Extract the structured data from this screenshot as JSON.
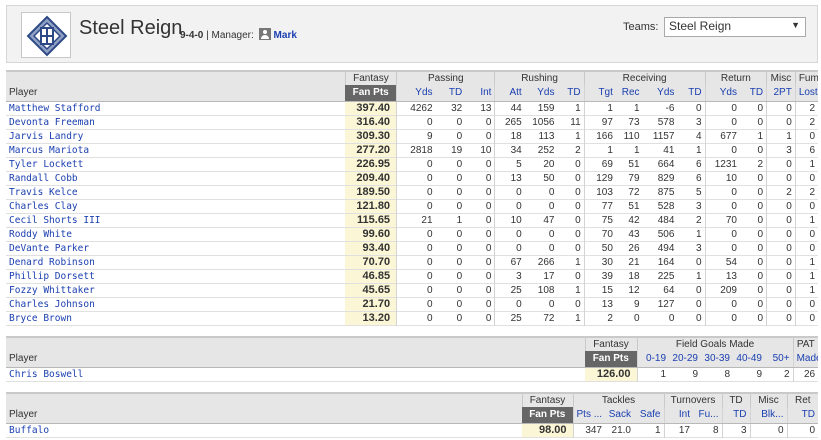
{
  "header": {
    "team_name": "Steel Reign",
    "record": "9-4-0",
    "manager_label": "| Manager:",
    "manager_name": "Mark",
    "teams_label": "Teams:",
    "teams_selected": "Steel Reign",
    "logo": "helmet-logo-icon"
  },
  "offense": {
    "groups": [
      "Fantasy",
      "Passing",
      "Rushing",
      "Receiving",
      "Return",
      "Misc",
      "Fum"
    ],
    "columns": [
      "Player",
      "Fan Pts",
      "Yds",
      "TD",
      "Int",
      "Att",
      "Yds",
      "TD",
      "Tgt",
      "Rec",
      "Yds",
      "TD",
      "Yds",
      "TD",
      "2PT",
      "Lost"
    ],
    "rows": [
      {
        "name": "Matthew Stafford",
        "pts": "397.40",
        "stats": [
          "4262",
          "32",
          "13",
          "44",
          "159",
          "1",
          "1",
          "1",
          "-6",
          "0",
          "0",
          "0",
          "0",
          "2"
        ]
      },
      {
        "name": "Devonta Freeman",
        "pts": "316.40",
        "stats": [
          "0",
          "0",
          "0",
          "265",
          "1056",
          "11",
          "97",
          "73",
          "578",
          "3",
          "0",
          "0",
          "0",
          "2"
        ]
      },
      {
        "name": "Jarvis Landry",
        "pts": "309.30",
        "stats": [
          "9",
          "0",
          "0",
          "18",
          "113",
          "1",
          "166",
          "110",
          "1157",
          "4",
          "677",
          "1",
          "1",
          "0"
        ]
      },
      {
        "name": "Marcus Mariota",
        "pts": "277.20",
        "stats": [
          "2818",
          "19",
          "10",
          "34",
          "252",
          "2",
          "1",
          "1",
          "41",
          "1",
          "0",
          "0",
          "3",
          "6"
        ]
      },
      {
        "name": "Tyler Lockett",
        "pts": "226.95",
        "stats": [
          "0",
          "0",
          "0",
          "5",
          "20",
          "0",
          "69",
          "51",
          "664",
          "6",
          "1231",
          "2",
          "0",
          "1"
        ]
      },
      {
        "name": "Randall Cobb",
        "pts": "209.40",
        "stats": [
          "0",
          "0",
          "0",
          "13",
          "50",
          "0",
          "129",
          "79",
          "829",
          "6",
          "10",
          "0",
          "0",
          "0"
        ]
      },
      {
        "name": "Travis Kelce",
        "pts": "189.50",
        "stats": [
          "0",
          "0",
          "0",
          "0",
          "0",
          "0",
          "103",
          "72",
          "875",
          "5",
          "0",
          "0",
          "2",
          "2"
        ]
      },
      {
        "name": "Charles Clay",
        "pts": "121.80",
        "stats": [
          "0",
          "0",
          "0",
          "0",
          "0",
          "0",
          "77",
          "51",
          "528",
          "3",
          "0",
          "0",
          "0",
          "0"
        ]
      },
      {
        "name": "Cecil Shorts III",
        "pts": "115.65",
        "stats": [
          "21",
          "1",
          "0",
          "10",
          "47",
          "0",
          "75",
          "42",
          "484",
          "2",
          "70",
          "0",
          "0",
          "1"
        ]
      },
      {
        "name": "Roddy White",
        "pts": "99.60",
        "stats": [
          "0",
          "0",
          "0",
          "0",
          "0",
          "0",
          "70",
          "43",
          "506",
          "1",
          "0",
          "0",
          "0",
          "0"
        ]
      },
      {
        "name": "DeVante Parker",
        "pts": "93.40",
        "stats": [
          "0",
          "0",
          "0",
          "0",
          "0",
          "0",
          "50",
          "26",
          "494",
          "3",
          "0",
          "0",
          "0",
          "0"
        ]
      },
      {
        "name": "Denard Robinson",
        "pts": "70.70",
        "stats": [
          "0",
          "0",
          "0",
          "67",
          "266",
          "1",
          "30",
          "21",
          "164",
          "0",
          "54",
          "0",
          "0",
          "1"
        ]
      },
      {
        "name": "Phillip Dorsett",
        "pts": "46.85",
        "stats": [
          "0",
          "0",
          "0",
          "3",
          "17",
          "0",
          "39",
          "18",
          "225",
          "1",
          "13",
          "0",
          "0",
          "1"
        ]
      },
      {
        "name": "Fozzy Whittaker",
        "pts": "45.65",
        "stats": [
          "0",
          "0",
          "0",
          "25",
          "108",
          "1",
          "15",
          "12",
          "64",
          "0",
          "209",
          "0",
          "0",
          "1"
        ]
      },
      {
        "name": "Charles Johnson",
        "pts": "21.70",
        "stats": [
          "0",
          "0",
          "0",
          "0",
          "0",
          "0",
          "13",
          "9",
          "127",
          "0",
          "0",
          "0",
          "0",
          "0"
        ]
      },
      {
        "name": "Bryce Brown",
        "pts": "13.20",
        "stats": [
          "0",
          "0",
          "0",
          "25",
          "72",
          "1",
          "2",
          "0",
          "0",
          "0",
          "0",
          "0",
          "0",
          "0"
        ]
      }
    ]
  },
  "kicker": {
    "groups": [
      "Fantasy",
      "Field Goals Made",
      "PAT"
    ],
    "columns": [
      "Player",
      "Fan Pts",
      "0-19",
      "20-29",
      "30-39",
      "40-49",
      "50+",
      "Made"
    ],
    "rows": [
      {
        "name": "Chris Boswell",
        "pts": "126.00",
        "stats": [
          "1",
          "9",
          "8",
          "9",
          "2",
          "26"
        ]
      }
    ]
  },
  "defense": {
    "groups": [
      "Fantasy",
      "Tackles",
      "Turnovers",
      "TD",
      "Misc",
      "Ret"
    ],
    "columns": [
      "Player",
      "Fan Pts",
      "Pts ...",
      "Sack",
      "Safe",
      "Int",
      "Fu...",
      "TD",
      "Blk...",
      "TD"
    ],
    "rows": [
      {
        "name": "Buffalo",
        "pts": "98.00",
        "stats": [
          "347",
          "21.0",
          "1",
          "17",
          "8",
          "3",
          "0",
          "0"
        ]
      }
    ]
  }
}
